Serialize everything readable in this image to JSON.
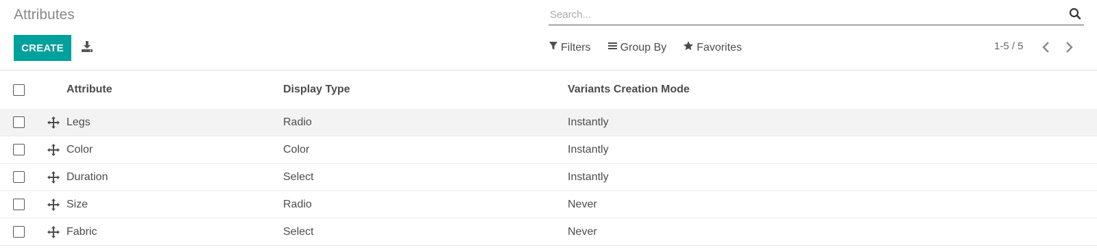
{
  "breadcrumb": "Attributes",
  "search": {
    "placeholder": "Search..."
  },
  "toolbar": {
    "create_label": "CREATE"
  },
  "filters": {
    "filters_label": "Filters",
    "groupby_label": "Group By",
    "favorites_label": "Favorites"
  },
  "pager": {
    "value": "1-5 / 5"
  },
  "table": {
    "headers": [
      "Attribute",
      "Display Type",
      "Variants Creation Mode"
    ],
    "rows": [
      {
        "attribute": "Legs",
        "display_type": "Radio",
        "mode": "Instantly"
      },
      {
        "attribute": "Color",
        "display_type": "Color",
        "mode": "Instantly"
      },
      {
        "attribute": "Duration",
        "display_type": "Select",
        "mode": "Instantly"
      },
      {
        "attribute": "Size",
        "display_type": "Radio",
        "mode": "Never"
      },
      {
        "attribute": "Fabric",
        "display_type": "Select",
        "mode": "Never"
      }
    ]
  },
  "colors": {
    "accent": "#00a09d",
    "text": "#4c4c4c",
    "muted": "#888888"
  },
  "icons": {
    "search": "search-icon",
    "download": "download-icon",
    "filter": "filter-icon",
    "groupby": "bars-icon",
    "favorites": "star-icon",
    "prev": "chevron-left-icon",
    "next": "chevron-right-icon",
    "handle": "move-arrows-icon"
  }
}
